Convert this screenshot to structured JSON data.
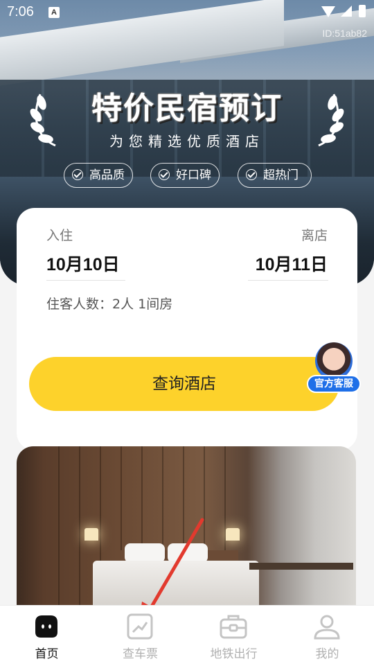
{
  "status_bar": {
    "time": "7:06",
    "notification": "A"
  },
  "watermark_id": "ID:51ab82",
  "hero": {
    "title": "特价民宿预订",
    "subtitle": "为您精选优质酒店",
    "badges": [
      "高品质",
      "好口碑",
      "超热门"
    ]
  },
  "booking": {
    "checkin_label": "入住",
    "checkin_date": "10月10日",
    "checkout_label": "离店",
    "checkout_date": "10月11日",
    "guests": "住客人数：2人 1间房",
    "search_button": "查询酒店"
  },
  "customer_service": {
    "label": "官方客服"
  },
  "tabs": [
    {
      "label": "首页",
      "icon": "home-face-icon",
      "active": true
    },
    {
      "label": "查车票",
      "icon": "ticket-chart-icon",
      "active": false
    },
    {
      "label": "地铁出行",
      "icon": "metro-icon",
      "active": false
    },
    {
      "label": "我的",
      "icon": "profile-icon",
      "active": false
    }
  ],
  "colors": {
    "accent": "#fdd22b",
    "service_blue": "#1e6fe8",
    "arrow_red": "#e23a2e"
  }
}
